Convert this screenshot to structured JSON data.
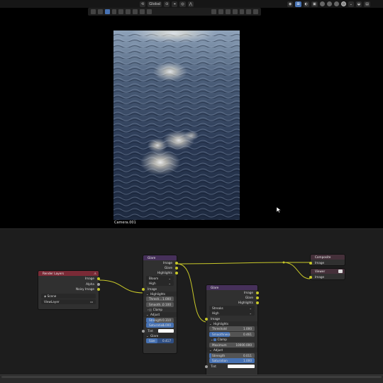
{
  "toolbar": {
    "transform_orientation": "Global",
    "accent": "#4772b3"
  },
  "viewport": {
    "camera_label": "Camera.001"
  },
  "nodes": {
    "render_layers": {
      "title": "Render Layers",
      "outputs": [
        "Image",
        "Alpha",
        "Noisy Image"
      ],
      "scene": "Scene",
      "view_layer": "ViewLayer"
    },
    "glare1": {
      "title": "Glare",
      "outputs": [
        "Image",
        "Glare",
        "Highlights"
      ],
      "type": "Bloom",
      "quality": "High",
      "input": "Image",
      "highlights_section": "Highlights",
      "threshold_label": "Thresh...",
      "threshold_value": "1.000",
      "smoothness_label": "Smooth...",
      "smoothness_value": "0.100",
      "clamp_label": "Clamp",
      "adjust_section": "Adjust",
      "strength_label": "Strength",
      "strength_value": "0.310",
      "saturation_label": "Saturation",
      "saturation_value": "1.000",
      "tint_label": "Tint",
      "glare_section": "Glare",
      "size_label": "Size",
      "size_value": "0.417"
    },
    "glare2": {
      "title": "Glare",
      "outputs": [
        "Image",
        "Glare",
        "Highlights"
      ],
      "type": "Streaks",
      "quality": "High",
      "input": "Image",
      "highlights_section": "Highlights",
      "threshold_label": "Threshold",
      "threshold_value": "1.000",
      "smoothness_label": "Smoothness",
      "smoothness_value": "0.461",
      "clamp_label": "Clamp",
      "maximum_label": "Maximum",
      "maximum_value": "10000.000",
      "adjust_section": "Adjust",
      "strength_label": "Strength",
      "strength_value": "0.011",
      "saturation_label": "Saturation",
      "saturation_value": "1.000",
      "tint_label": "Tint"
    },
    "composite": {
      "title": "Composite",
      "input": "Image"
    },
    "viewer": {
      "title": "Viewer",
      "input": "Image"
    }
  }
}
